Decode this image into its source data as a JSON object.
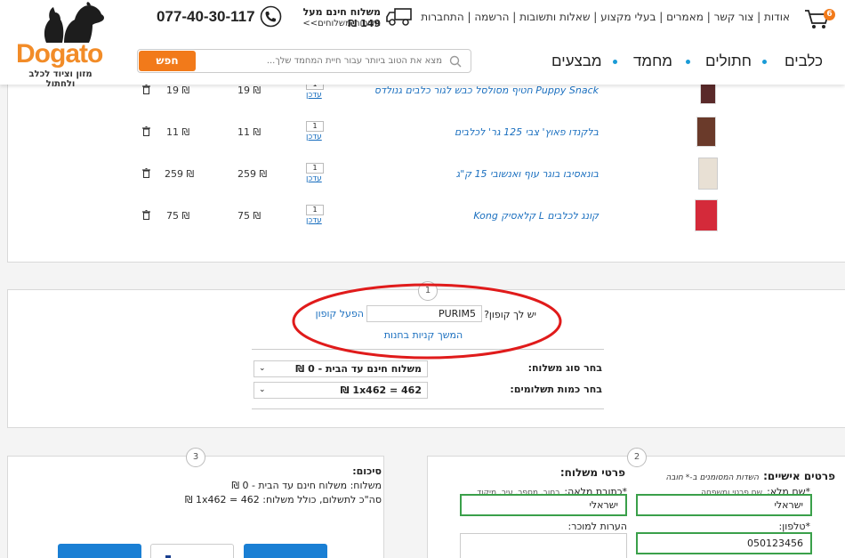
{
  "header": {
    "logo": {
      "word": "Dogato",
      "tagline": "מזון וציוד לכלב ולחתול"
    },
    "phone": "077-40-30-117",
    "shipping": {
      "title": "משלוח חינם מעל 149 ₪",
      "policy": "מדיניות משלוחים>>"
    },
    "top_links": [
      "אודות",
      "צור קשר",
      "מאמרים",
      "בעלי מקצוע",
      "שאלות ותשובות",
      "הרשמה",
      "התחברות"
    ],
    "cart_count": "6",
    "search": {
      "placeholder": "מצא את הטוב ביותר עבור חיית המחמד שלך...",
      "button": "חפש"
    },
    "nav": [
      "כלבים",
      "חתולים",
      "מחמד",
      "מבצעים"
    ]
  },
  "cart": {
    "update_label": "עדכן",
    "rows": [
      {
        "name": "Puppy Snack חטיף מסולסל כבש לגור כלבים גנולדס",
        "qty": "1",
        "price": "19 ₪",
        "total": "19 ₪"
      },
      {
        "name": "בלקנדו פאוץ' צבי 125 גר' לכלבים",
        "qty": "1",
        "price": "11 ₪",
        "total": "11 ₪"
      },
      {
        "name": "בונאסיבו בוגר עוף ואנשובי 15 ק\"ג",
        "qty": "1",
        "price": "259 ₪",
        "total": "259 ₪"
      },
      {
        "name": "קונג לכלבים L קלאסיק Kong",
        "qty": "1",
        "price": "75 ₪",
        "total": "75 ₪"
      }
    ]
  },
  "coupon": {
    "step": "1",
    "question": "יש לך קופון?",
    "value": "PURIM5",
    "apply": "הפעל קופון",
    "continue": "המשך קניות בחנות",
    "shipping_type_label": "בחר סוג משלוח:",
    "shipping_type_value": "משלוח חינם עד הבית - 0 ₪",
    "payments_label": "בחר כמות תשלומים:",
    "payments_value": "462 = 1x462 ₪"
  },
  "summary": {
    "step": "3",
    "title": "סיכום:",
    "shipping_line": "משלוח: משלוח חינם עד הבית - 0 ₪",
    "total_line": "סה\"כ לתשלום, כולל משלוח: 462 = 1x462 ₪"
  },
  "details": {
    "step": "2",
    "personal_title": "פרטים אישיים:",
    "required_note": "השדות המסומנים ב-* חובה",
    "name_label": "*שם מלא:",
    "name_hint": "שם פרטי ומשפחה",
    "name_value": "ישראלי",
    "phone_label": "*טלפון:",
    "phone_value": "050123456",
    "shipping_title": "פרטי משלוח:",
    "address_label": "*כתובת מלאה:",
    "address_hint": "רחוב, מספר, עיר, מיקוד",
    "address_value": "ישראלי",
    "notes_label": "הערות למוכר:"
  },
  "colors": {
    "accent": "#f27a1a",
    "link": "#1a6fbf",
    "nav_dot": "#1a9bd7",
    "annotation": "#e01b1b",
    "valid": "#3aa04a"
  }
}
